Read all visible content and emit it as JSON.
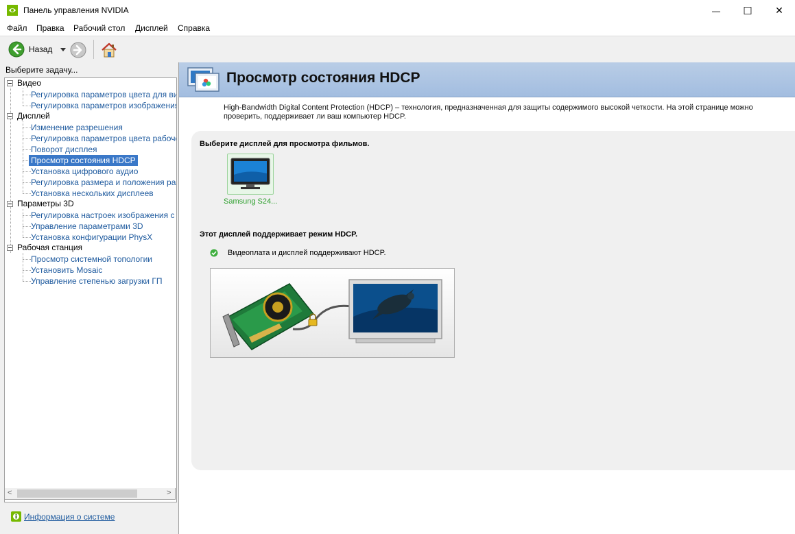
{
  "window": {
    "title": "Панель управления NVIDIA",
    "minimize_symbol": "—",
    "maximize_symbol": "☐",
    "close_symbol": "✕"
  },
  "menu": [
    "Файл",
    "Правка",
    "Рабочий стол",
    "Дисплей",
    "Справка"
  ],
  "toolbar": {
    "back_label": "Назад"
  },
  "sidebar": {
    "task_label": "Выберите задачу...",
    "categories": [
      {
        "label": "Видео",
        "items": [
          "Регулировка параметров цвета для вид",
          "Регулировка параметров изображения д"
        ]
      },
      {
        "label": "Дисплей",
        "items": [
          "Изменение разрешения",
          "Регулировка параметров цвета рабочег",
          "Поворот дисплея",
          "Просмотр состояния HDCP",
          "Установка цифрового аудио",
          "Регулировка размера и положения рабо",
          "Установка нескольких дисплеев"
        ]
      },
      {
        "label": "Параметры 3D",
        "items": [
          "Регулировка настроек изображения с пр",
          "Управление параметрами 3D",
          "Установка конфигурации PhysX"
        ]
      },
      {
        "label": "Рабочая станция",
        "items": [
          "Просмотр системной топологии",
          "Установить Mosaic",
          "Управление степенью загрузки ГП"
        ]
      }
    ],
    "selected_item": "Просмотр состояния HDCP",
    "scroll_left": "<",
    "scroll_right": ">",
    "system_info_link": "Информация о системе"
  },
  "main": {
    "title": "Просмотр состояния HDCP",
    "description": "High-Bandwidth Digital Content Protection (HDCP) – технология, предназначенная для защиты содержимого высокой четкости. На этой странице можно проверить, поддерживает ли ваш компьютер HDCP.",
    "select_display_label": "Выберите дисплей для просмотра фильмов.",
    "display_name": "Samsung S24...",
    "support_heading": "Этот дисплей поддерживает режим HDCP.",
    "support_status": "Видеоплата и дисплей поддерживают HDCP."
  },
  "colors": {
    "accent_link": "#1e5a9e",
    "selection": "#3a78c8",
    "header_band": "#a2bde0",
    "status_ok": "#2ea02e",
    "nvidia_green": "#76b900"
  },
  "icons": {
    "app": "nvidia-logo-icon",
    "back": "back-arrow-icon",
    "forward": "forward-arrow-icon",
    "home": "home-icon",
    "status": "check-circle-icon",
    "system_info": "nvidia-info-icon"
  }
}
